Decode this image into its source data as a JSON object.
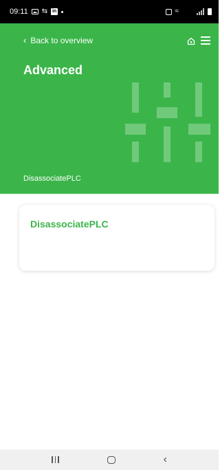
{
  "status_bar": {
    "time": "09:11"
  },
  "header": {
    "back_label": "Back to overview",
    "title": "Advanced",
    "subtitle": "DisassociatePLC",
    "color": "#3bb54a"
  },
  "card": {
    "title": "DisassociatePLC"
  },
  "icons": {
    "back": "chevron-left-icon",
    "home": "home-icon",
    "menu": "hamburger-menu-icon"
  }
}
